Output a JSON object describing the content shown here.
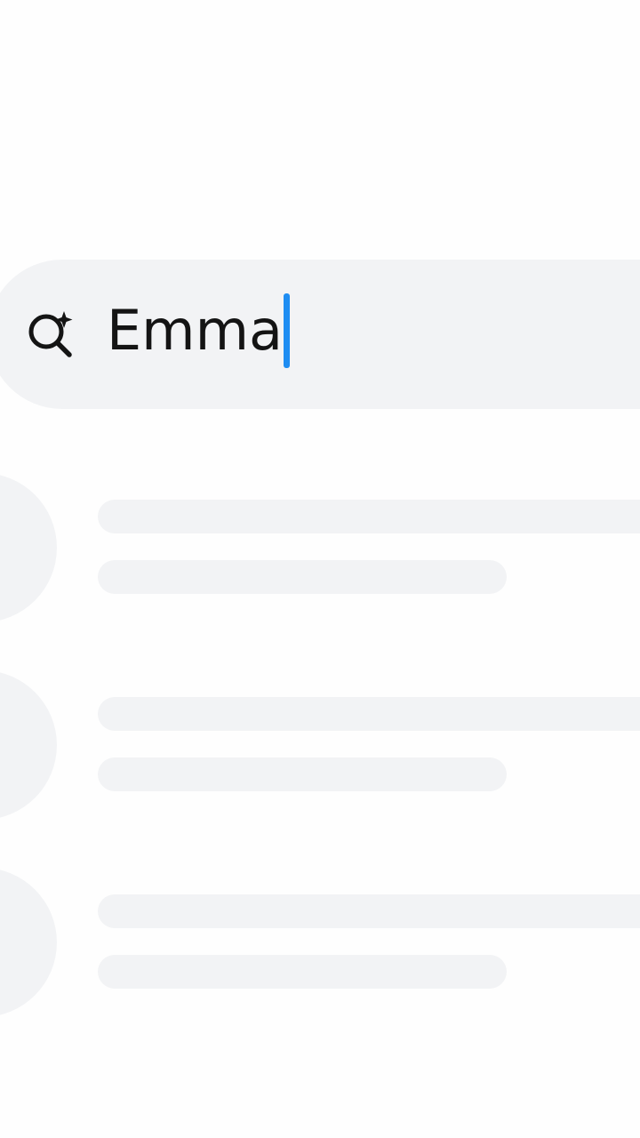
{
  "search": {
    "query": "Emma",
    "icon": "ai-search-icon",
    "caret_color": "#1e8df2",
    "background_color": "#f2f3f5"
  },
  "results": {
    "state": "loading",
    "placeholder_count": 3,
    "placeholder_color": "#f2f3f5"
  }
}
